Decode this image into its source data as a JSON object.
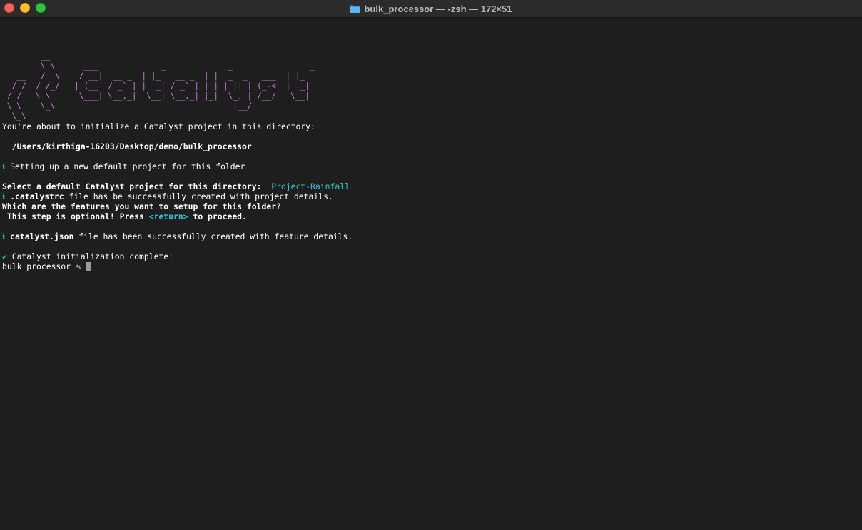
{
  "window": {
    "title": "bulk_processor — -zsh — 172×51"
  },
  "ascii_logo": [
    "        __",
    "        \\ \\      ___             _             _                _",
    "   __   /  \\    / __|  __ _  | |_   __ _  | |  _  _   ___  | |_",
    "  / /  / /_/   | (__  / _` | |  _| / _` | | | | || | (_-<  |  _|",
    " / /   \\ \\      \\___| \\__,_|  \\__| \\__,_| |_|  \\_, | /__/   \\__|",
    " \\ \\    \\_\\                                     |__/",
    "  \\_\\"
  ],
  "lines": {
    "intro": "You're about to initialize a Catalyst project in this directory:",
    "path": "  /Users/kirthiga-16203/Desktop/demo/bulk_processor",
    "info_symbol": "ℹ",
    "setup": " Setting up a new default project for this folder",
    "select_prompt": "Select a default Catalyst project for this directory:  ",
    "select_value": "Project-Rainfall",
    "rc_file": " .catalystrc",
    "rc_rest": " file has be successfully created with project details.",
    "features_prompt": "Which are the features you want to setup for this folder?",
    "optional_pre": " This step is optional! Press ",
    "optional_key": "<return>",
    "optional_post": " to proceed.",
    "json_file": " catalyst.json",
    "json_rest": " file has been successfully created with feature details.",
    "check_symbol": "✔",
    "complete": " Catalyst initialization complete!",
    "prompt": "bulk_processor % "
  },
  "colors": {
    "background": "#1e1e1e",
    "logo": "#d07ae0",
    "accent": "#2ec6d6",
    "success": "#2fbf4a"
  }
}
